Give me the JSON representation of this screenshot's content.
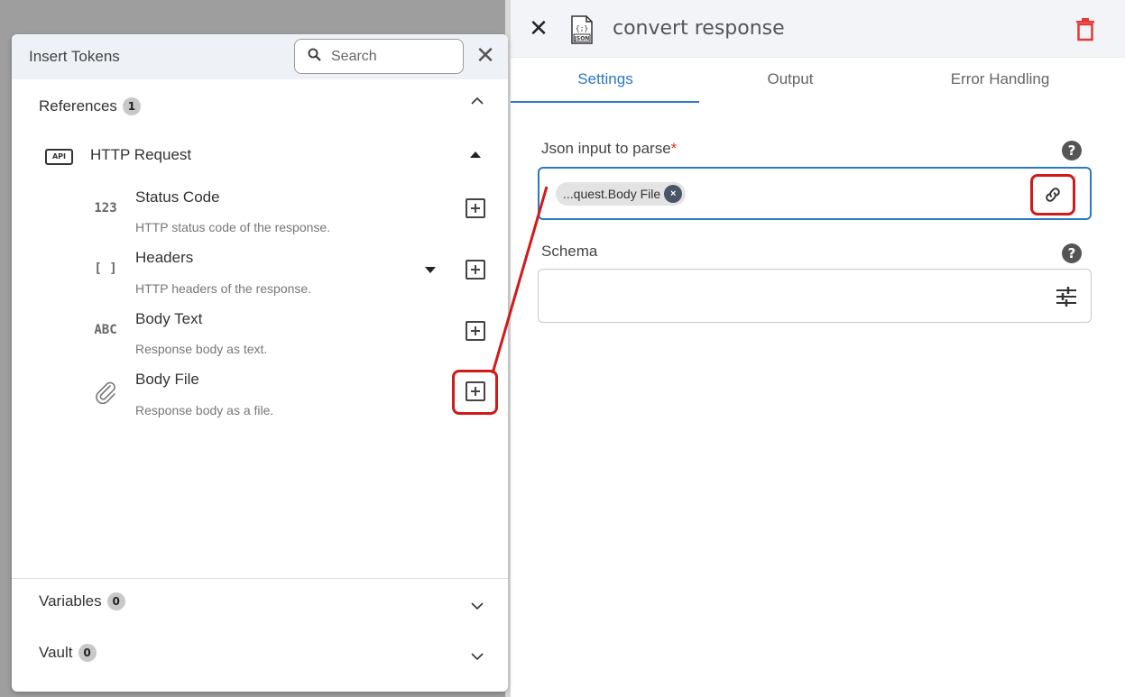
{
  "right_panel": {
    "title": "convert response",
    "icons": {
      "close": "close-icon",
      "file": "json-file-icon",
      "delete": "trash-icon"
    },
    "delete_color": "#e53935",
    "tabs": [
      {
        "label": "Settings",
        "active": true
      },
      {
        "label": "Output",
        "active": false
      },
      {
        "label": "Error Handling",
        "active": false
      }
    ],
    "json_input": {
      "label": "Json input to parse",
      "required_mark": "*",
      "chip_text": "...quest.Body File",
      "chip_remove": "×"
    },
    "schema": {
      "label": "Schema"
    },
    "help_symbol": "?"
  },
  "tokens_panel": {
    "title": "Insert Tokens",
    "search_placeholder": "Search",
    "close_symbol": "✕",
    "sections": {
      "references": {
        "label": "References",
        "count": "1"
      },
      "variables": {
        "label": "Variables",
        "count": "0"
      },
      "vault": {
        "label": "Vault",
        "count": "0"
      }
    },
    "http_request": {
      "label": "HTTP Request",
      "icon_text": "API"
    },
    "tokens": [
      {
        "icon_text": "123",
        "name": "Status Code",
        "description": "HTTP status code of the response."
      },
      {
        "icon_text": "[ ]",
        "name": "Headers",
        "description": "HTTP headers of the response."
      },
      {
        "icon_text": "ABC",
        "name": "Body Text",
        "description": "Response body as text."
      },
      {
        "icon_text": "",
        "name": "Body File",
        "description": "Response body as a file."
      }
    ]
  },
  "colors": {
    "accent": "#2a79c2",
    "highlight": "#d11a1a",
    "required": "#d9362b"
  }
}
